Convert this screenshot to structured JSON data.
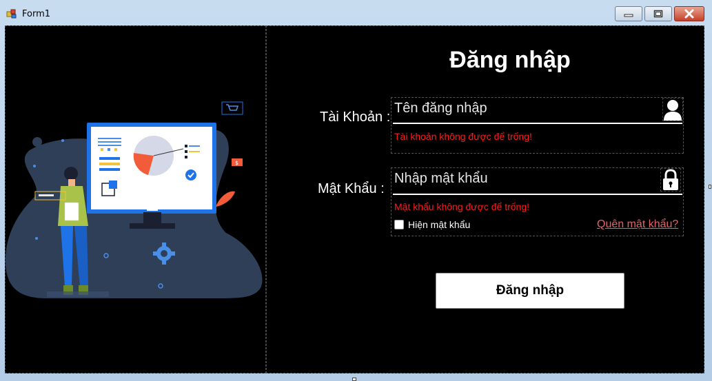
{
  "window": {
    "title": "Form1"
  },
  "login": {
    "heading": "Đăng nhập",
    "username_label": "Tài Khoản :",
    "username_placeholder": "Tên đăng nhập",
    "username_error": "Tài khoản không được để trống!",
    "password_label": "Mật Khẩu :",
    "password_placeholder": "Nhập mật khẩu",
    "password_error": "Mật khẩu không được để trống!",
    "show_password_label": "Hiện mật khẩu",
    "show_password_checked": false,
    "forgot_password": "Quên mật khẩu?",
    "submit_label": "Đăng nhập"
  },
  "icons": {
    "user": "user-icon",
    "lock": "lock-icon",
    "app": "app-icon",
    "minimize": "minimize-icon",
    "maximize": "maximize-icon",
    "close": "close-icon"
  },
  "colors": {
    "background": "#000000",
    "error": "#ff1a1a",
    "link": "#e36464",
    "close_button": "#c4412a"
  }
}
